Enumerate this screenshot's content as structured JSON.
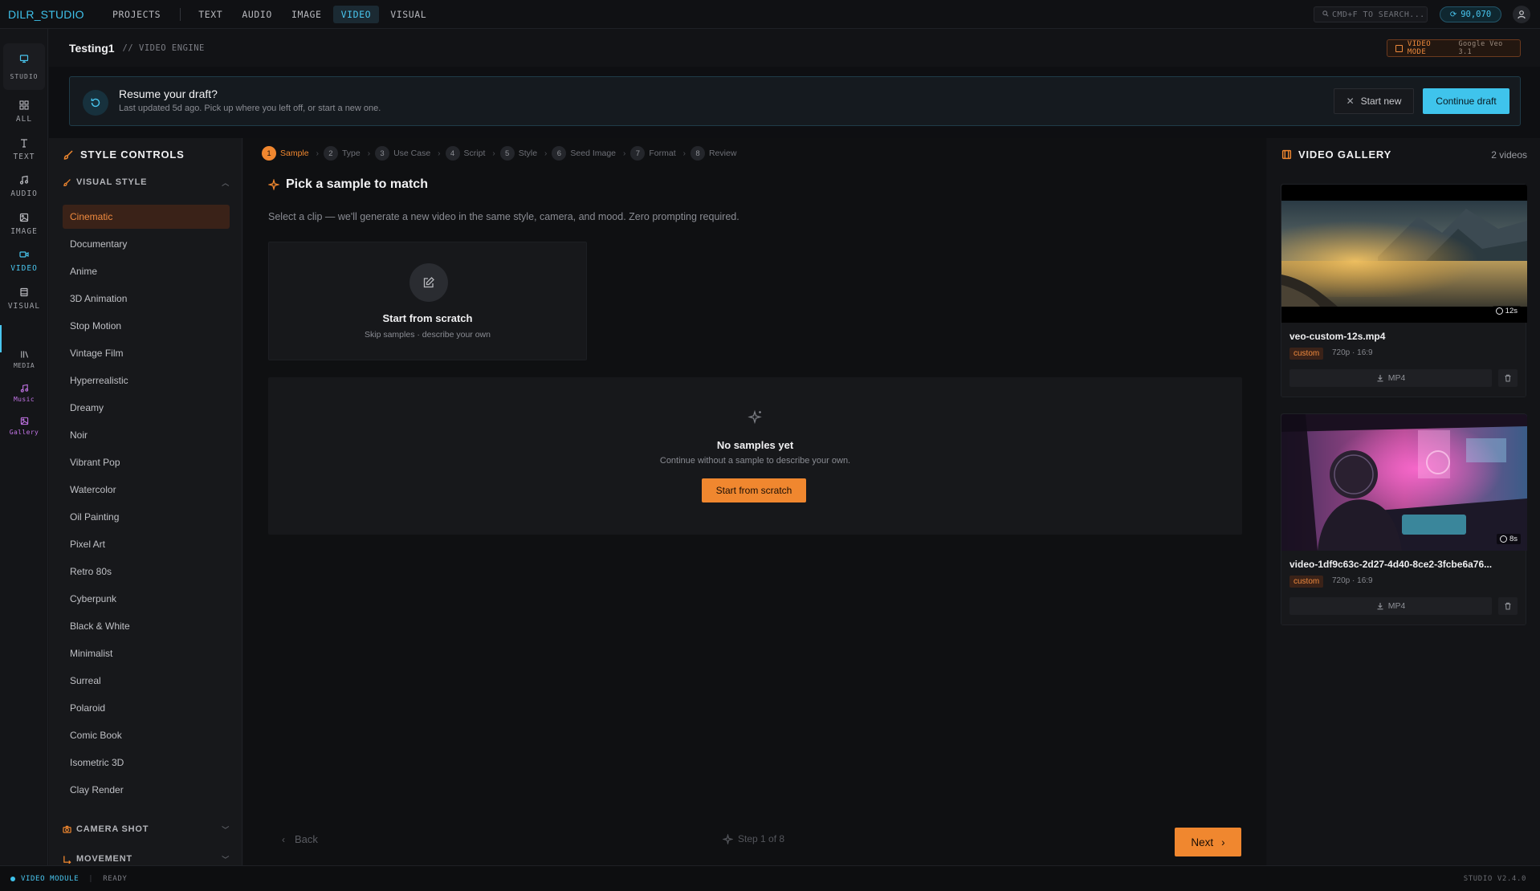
{
  "app": {
    "brand": "DILR_STUDIO"
  },
  "topnav": {
    "projects": "PROJECTS",
    "items": [
      "TEXT",
      "AUDIO",
      "IMAGE",
      "VIDEO",
      "VISUAL"
    ],
    "active": "VIDEO",
    "search_placeholder": "CMD+F TO SEARCH...",
    "credits": "90,070"
  },
  "rail": {
    "studio": "STUDIO",
    "items": [
      "ALL",
      "TEXT",
      "AUDIO",
      "IMAGE",
      "VIDEO",
      "VISUAL"
    ],
    "active": "VIDEO",
    "secondary": [
      "MEDIA",
      "Music",
      "Gallery"
    ]
  },
  "header": {
    "title": "Testing1",
    "subtitle": "// VIDEO ENGINE",
    "mode": "VIDEO MODE",
    "model": "Google Veo 3.1"
  },
  "draft": {
    "title": "Resume your draft?",
    "subtitle": "Last updated 5d ago. Pick up where you left off, or start a new one.",
    "start_new": "Start new",
    "continue": "Continue draft"
  },
  "style_controls": {
    "title": "STYLE CONTROLS",
    "visual_style": "VISUAL STYLE",
    "styles": [
      "Cinematic",
      "Documentary",
      "Anime",
      "3D Animation",
      "Stop Motion",
      "Vintage Film",
      "Hyperrealistic",
      "Dreamy",
      "Noir",
      "Vibrant Pop",
      "Watercolor",
      "Oil Painting",
      "Pixel Art",
      "Retro 80s",
      "Cyberpunk",
      "Black & White",
      "Minimalist",
      "Surreal",
      "Polaroid",
      "Comic Book",
      "Isometric 3D",
      "Clay Render"
    ],
    "active_style": "Cinematic",
    "camera_shot": "CAMERA SHOT",
    "movement": "MOVEMENT"
  },
  "steps": [
    {
      "num": "1",
      "label": "Sample"
    },
    {
      "num": "2",
      "label": "Type"
    },
    {
      "num": "3",
      "label": "Use Case"
    },
    {
      "num": "4",
      "label": "Script"
    },
    {
      "num": "5",
      "label": "Style"
    },
    {
      "num": "6",
      "label": "Seed Image"
    },
    {
      "num": "7",
      "label": "Format"
    },
    {
      "num": "8",
      "label": "Review"
    }
  ],
  "main": {
    "title": "Pick a sample to match",
    "subtitle": "Select a clip — we'll generate a new video in the same style, camera, and mood. Zero prompting required.",
    "scratch_title": "Start from scratch",
    "scratch_sub": "Skip samples · describe your own",
    "empty_title": "No samples yet",
    "empty_sub": "Continue without a sample to describe your own.",
    "empty_button": "Start from scratch",
    "back": "Back",
    "step_indicator": "Step 1 of 8",
    "next": "Next"
  },
  "gallery": {
    "title": "VIDEO GALLERY",
    "count": "2 videos",
    "videos": [
      {
        "name": "veo-custom-12s.mp4",
        "tag": "custom",
        "meta": "720p · 16:9",
        "duration": "12s",
        "download": "MP4"
      },
      {
        "name": "video-1df9c63c-2d27-4d40-8ce2-3fcbe6a76...",
        "tag": "custom",
        "meta": "720p · 16:9",
        "duration": "8s",
        "download": "MP4"
      }
    ]
  },
  "status": {
    "module": "VIDEO MODULE",
    "state": "READY",
    "version": "STUDIO V2.4.0"
  },
  "colors": {
    "accent_cyan": "#3fc4ec",
    "accent_orange": "#f0872f"
  }
}
